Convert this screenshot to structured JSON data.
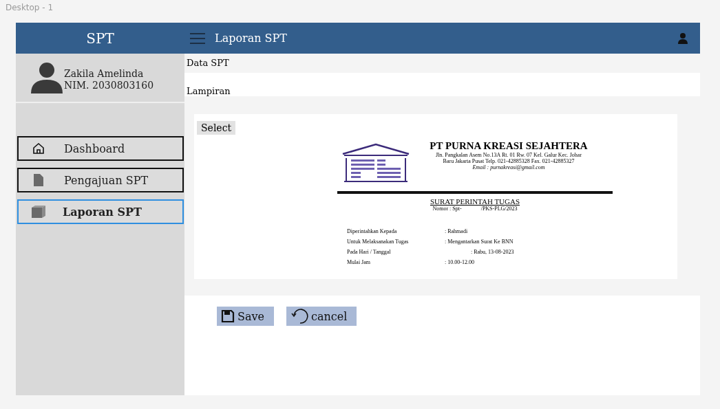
{
  "canvas_label": "Desktop - 1",
  "sidebar": {
    "brand": "SPT",
    "user": {
      "name": "Zakila Amelinda",
      "id": "NIM. 2030803160"
    },
    "items": [
      {
        "label": "Dashboard",
        "selected": false
      },
      {
        "label": "Pengajuan SPT",
        "selected": false
      },
      {
        "label": "Laporan SPT",
        "selected": true
      }
    ]
  },
  "header": {
    "title": "Laporan SPT"
  },
  "section": {
    "title": "Data SPT",
    "field_label": "Lampiran",
    "select_button": "Select"
  },
  "document": {
    "company": "PT PURNA KREASI SEJAHTERA",
    "address": [
      "Jln. Pangkalan Asem No.13A Rt. 01 Rw. 07 Kel. Galur Kec. Johar",
      "Baru Jakarta Pusat  Telp. 021-42885328 Fax. 021-42885327"
    ],
    "email": "Email : purnakreasi@gmail.com",
    "heading": "SURAT PERINTAH TUGAS",
    "number_label": "Nomor : Spt-",
    "number_suffix": "/PKS-PLG/2023",
    "fields": [
      {
        "label": "Diperintahkan Kepada",
        "value": ": Rahmadi"
      },
      {
        "label": "Untuk Melaksanakan Tugas",
        "value": ": Mengantarkan Surat Ke BNN"
      },
      {
        "label": "Pada Hari / Tanggal",
        "value": ": Rabu, 13-08-2023"
      },
      {
        "label": "Mulai Jam",
        "value": ": 10.00-12.00"
      }
    ]
  },
  "buttons": [
    {
      "kind": "save",
      "label": "Save"
    },
    {
      "kind": "cancel",
      "label": "cancel"
    }
  ]
}
